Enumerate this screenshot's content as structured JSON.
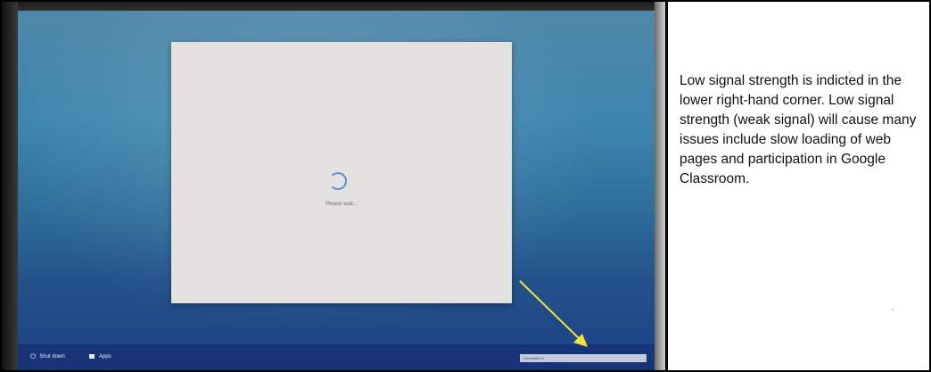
{
  "photo": {
    "dialog": {
      "loading_text": "Please wait..."
    },
    "shelf": {
      "shutdown_label": "Shut down",
      "apps_label": "Apps",
      "status_text": "Connected to"
    },
    "arrow_color": "#f3e33a",
    "icons": {
      "spinner": "loading-spinner-icon",
      "power": "power-icon",
      "apps": "apps-icon",
      "arrow": "arrow-icon"
    }
  },
  "caption": {
    "text": "Low signal strength is indicted in the lower right-hand corner. Low signal strength (weak signal) will cause many issues include slow loading of web pages and participation in Google Classroom."
  }
}
